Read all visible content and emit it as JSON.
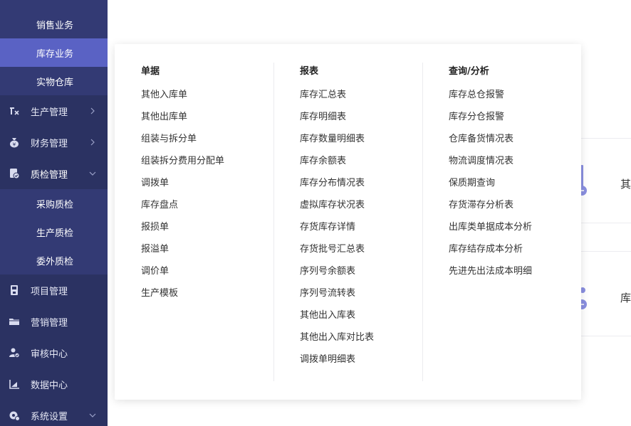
{
  "sidebar": {
    "top_subitems": [
      {
        "label": "销售业务",
        "active": false
      },
      {
        "label": "库存业务",
        "active": true
      },
      {
        "label": "实物仓库",
        "active": false
      }
    ],
    "production": {
      "label": "生产管理",
      "icon": "production-icon",
      "arrow": "chevron-right"
    },
    "finance": {
      "label": "财务管理",
      "icon": "money-bag-icon",
      "arrow": "chevron-right"
    },
    "quality": {
      "label": "质检管理",
      "icon": "quality-check-icon",
      "arrow": "chevron-down",
      "subitems": [
        {
          "label": "采购质检"
        },
        {
          "label": "生产质检"
        },
        {
          "label": "委外质检"
        }
      ]
    },
    "project": {
      "label": "项目管理",
      "icon": "save-disk-icon"
    },
    "marketing": {
      "label": "营销管理",
      "icon": "folder-icon"
    },
    "audit": {
      "label": "审核中心",
      "icon": "audit-icon"
    },
    "data": {
      "label": "数据中心",
      "icon": "chart-icon"
    },
    "settings": {
      "label": "系统设置",
      "icon": "settings-icon",
      "arrow": "chevron-down"
    }
  },
  "menu": {
    "columns": [
      {
        "title": "单据",
        "items": [
          "其他入库单",
          "其他出库单",
          "组装与拆分单",
          "组装拆分费用分配单",
          "调拨单",
          "库存盘点",
          "报损单",
          "报溢单",
          "调价单",
          "生产模板"
        ]
      },
      {
        "title": "报表",
        "items": [
          "库存汇总表",
          "库存明细表",
          "库存数量明细表",
          "库存余额表",
          "库存分布情况表",
          "虚拟库存状况表",
          "存货库存详情",
          "存货批号汇总表",
          "序列号余额表",
          "序列号流转表",
          "其他出入库表",
          "其他出入库对比表",
          "调拨单明细表"
        ]
      },
      {
        "title": "查询/分析",
        "items": [
          "库存总仓报警",
          "库存分仓报警",
          "仓库备货情况表",
          "物流调度情况表",
          "保质期查询",
          "存货滞存分析表",
          "出库类单据成本分析",
          "库存结存成本分析",
          "先进先出法成本明细"
        ]
      }
    ]
  },
  "background": {
    "card1_text": "其",
    "card2_text": "库"
  },
  "colors": {
    "sidebar_bg": "#2b3262",
    "sidebar_sub_bg": "#333a74",
    "active_bg": "#5a62c4",
    "accent": "#7a80d8"
  }
}
